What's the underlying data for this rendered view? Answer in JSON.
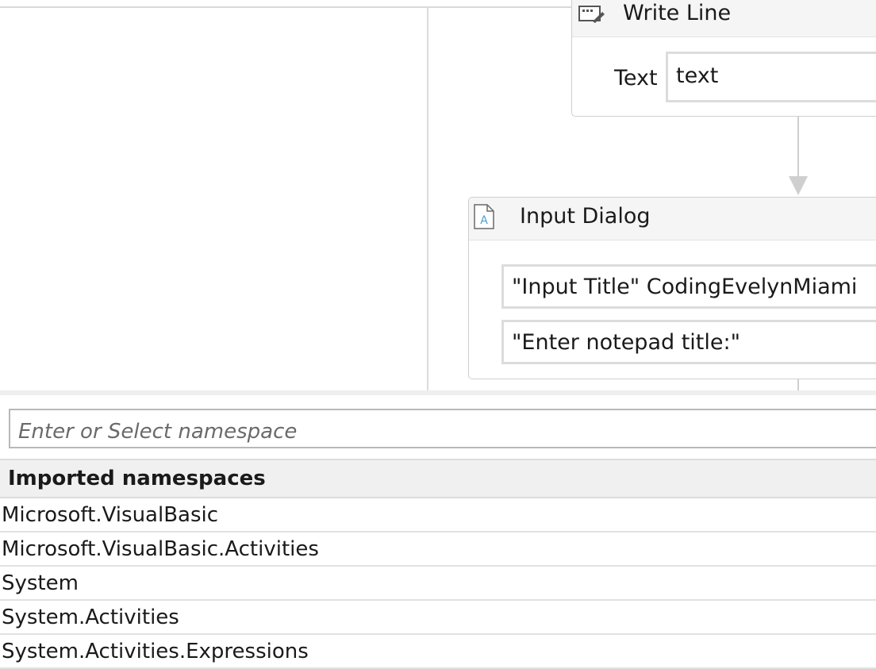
{
  "designer": {
    "write_line": {
      "title": "Write Line",
      "text_label": "Text",
      "text_value": "text"
    },
    "input_dialog": {
      "title": "Input Dialog",
      "title_field": "\"Input Title\" CodingEvelynMiami",
      "label_field": "\"Enter notepad title:\""
    }
  },
  "namespaces": {
    "search_placeholder": "Enter or Select namespace",
    "header": "Imported namespaces",
    "items": [
      "Microsoft.VisualBasic",
      "Microsoft.VisualBasic.Activities",
      "System",
      "System.Activities",
      "System.Activities.Expressions"
    ]
  },
  "colors": {
    "border": "#cfcfcf",
    "header_bg": "#f5f5f5",
    "icon_accent": "#4a9fd4"
  }
}
